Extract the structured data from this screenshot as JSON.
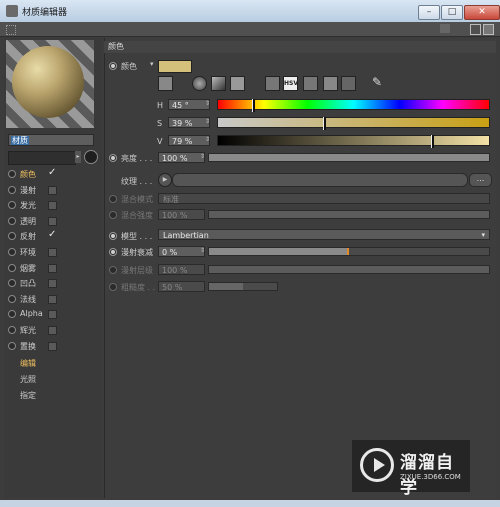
{
  "window": {
    "title": "材质编辑器",
    "minimize": "–",
    "maximize": "□",
    "close": "✕"
  },
  "material": {
    "name": "材质",
    "preview_colors": {
      "base": "#bba56e",
      "highlight": "#e8dca8",
      "shadow": "#3d3520"
    }
  },
  "channels": [
    {
      "label": "颜色",
      "checked": true,
      "active": true
    },
    {
      "label": "漫射",
      "checked": false
    },
    {
      "label": "发光",
      "checked": false
    },
    {
      "label": "透明",
      "checked": false
    },
    {
      "label": "反射",
      "checked": true
    },
    {
      "label": "环境",
      "checked": false
    },
    {
      "label": "烟雾",
      "checked": false
    },
    {
      "label": "凹凸",
      "checked": false
    },
    {
      "label": "法线",
      "checked": false
    },
    {
      "label": "Alpha",
      "checked": false
    },
    {
      "label": "辉光",
      "checked": false
    },
    {
      "label": "置换",
      "checked": false
    }
  ],
  "nav": [
    {
      "label": "编辑",
      "active": true
    },
    {
      "label": "光照"
    },
    {
      "label": "指定"
    }
  ],
  "color_section": {
    "heading": "颜色",
    "color_label": "颜色",
    "swatch_color": "#d4c07a",
    "hsv_tab": "HSV",
    "h": {
      "label": "H",
      "value": "45 °",
      "fraction": 0.125
    },
    "s": {
      "label": "S",
      "value": "39 %",
      "fraction": 0.39
    },
    "v": {
      "label": "V",
      "value": "79 %",
      "fraction": 0.79
    },
    "brightness": {
      "label": "亮度 . . .",
      "value": "100 %",
      "fraction": 1.0
    },
    "texture_label": "纹理 . . .",
    "texture_button": "...",
    "blend_mode": {
      "label": "混合模式",
      "value": "标准"
    },
    "blend_strength": {
      "label": "混合强度",
      "value": "100 %",
      "fraction": 1.0
    },
    "model": {
      "label": "模型 . . .",
      "value": "Lambertian"
    },
    "diffuse_falloff": {
      "label": "漫射衰减",
      "value": "0 %",
      "fraction": 0.5
    },
    "diffuse_level": {
      "label": "漫射层级",
      "value": "100 %",
      "fraction": 1.0
    },
    "roughness": {
      "label": "粗糙度 . . .",
      "value": "50 %",
      "fraction": 0.5
    }
  },
  "watermark": {
    "text": "溜溜自学",
    "url": "ZIXUE.3D66.COM"
  }
}
